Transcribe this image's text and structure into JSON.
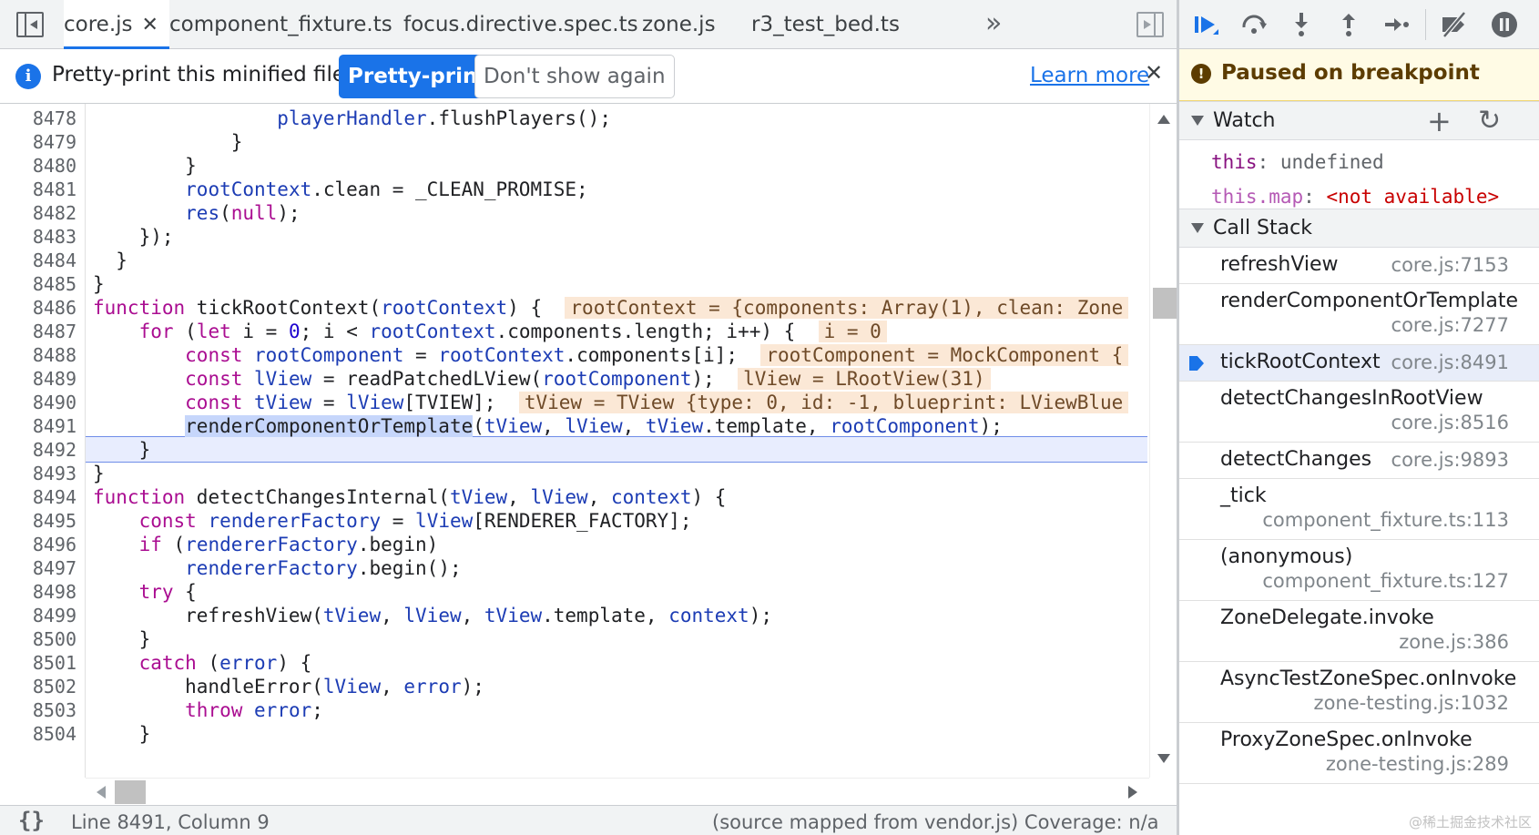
{
  "tabs": [
    {
      "label": "core.js",
      "active": true,
      "closable": true
    },
    {
      "label": "component_fixture.ts"
    },
    {
      "label": "focus.directive.spec.ts"
    },
    {
      "label": "zone.js"
    },
    {
      "label": "r3_test_bed.ts"
    }
  ],
  "icons": {
    "navigator": "sidebar-toggle-icon",
    "more_tabs": "double-chevron-right-icon",
    "debugger_toggle": "sidebar-toggle-icon",
    "info": "info-icon",
    "close": "close-icon",
    "resume": "resume-icon",
    "step_over": "step-over-icon",
    "step_into": "step-into-icon",
    "step_out": "step-out-icon",
    "step": "step-icon",
    "deactivate_breakpoints": "deactivate-breakpoints-icon",
    "pause_on_exceptions": "pause-icon",
    "add": "plus-icon",
    "refresh": "refresh-icon",
    "format": "curly-braces-icon"
  },
  "infobar": {
    "message": "Pretty-print this minified file?",
    "pretty_print": "Pretty-print",
    "dont_show": "Don't show again",
    "learn_more": "Learn more",
    "close": "✕"
  },
  "tab_close": "✕",
  "tabs_more": "»",
  "editor": {
    "lines": [
      {
        "no": "8478",
        "code": "                playerHandler.flushPlayers();"
      },
      {
        "no": "8479",
        "code": "            }"
      },
      {
        "no": "8480",
        "code": "        }"
      },
      {
        "no": "8481",
        "code": "        rootContext.clean = _CLEAN_PROMISE;"
      },
      {
        "no": "8482",
        "code": "        res(null);"
      },
      {
        "no": "8483",
        "code": "    });"
      },
      {
        "no": "8484",
        "code": "  }"
      },
      {
        "no": "8485",
        "code": "}"
      },
      {
        "no": "8486",
        "code": "function tickRootContext(rootContext) {",
        "inline": "rootContext = {components: Array(1), clean: Zone"
      },
      {
        "no": "8487",
        "code": "    for (let i = 0; i < rootContext.components.length; i++) {",
        "inline": "i = 0"
      },
      {
        "no": "8488",
        "code": "        const rootComponent = rootContext.components[i];",
        "inline": "rootComponent = MockComponent {"
      },
      {
        "no": "8489",
        "code": "        const lView = readPatchedLView(rootComponent);",
        "inline": "lView = LRootView(31)"
      },
      {
        "no": "8490",
        "code": "        const tView = lView[TVIEW];",
        "inline": "tView = TView {type: 0, id: -1, blueprint: LViewBlue"
      },
      {
        "no": "8491",
        "code": "        renderComponentOrTemplate(tView, lView, tView.template, rootComponent);",
        "current": true
      },
      {
        "no": "8492",
        "code": "    }"
      },
      {
        "no": "8493",
        "code": "}"
      },
      {
        "no": "8494",
        "code": "function detectChangesInternal(tView, lView, context) {"
      },
      {
        "no": "8495",
        "code": "    const rendererFactory = lView[RENDERER_FACTORY];"
      },
      {
        "no": "8496",
        "code": "    if (rendererFactory.begin)"
      },
      {
        "no": "8497",
        "code": "        rendererFactory.begin();"
      },
      {
        "no": "8498",
        "code": "    try {"
      },
      {
        "no": "8499",
        "code": "        refreshView(tView, lView, tView.template, context);"
      },
      {
        "no": "8500",
        "code": "    }"
      },
      {
        "no": "8501",
        "code": "    catch (error) {"
      },
      {
        "no": "8502",
        "code": "        handleError(lView, error);"
      },
      {
        "no": "8503",
        "code": "        throw error;"
      },
      {
        "no": "8504",
        "code": "    }"
      }
    ]
  },
  "statusbar": {
    "format": "{}",
    "cursor": "Line 8491, Column 9",
    "source": "(source mapped from vendor.js)  Coverage: n/a"
  },
  "debugger": {
    "paused_text": "Paused on breakpoint",
    "paused_icon": "!",
    "watch": {
      "title": "Watch",
      "add": "+",
      "refresh": "↻",
      "items": [
        {
          "key": "this",
          "sep": ": ",
          "value": "undefined"
        },
        {
          "key": "this.map",
          "sep": ": ",
          "value": "<not available>"
        }
      ]
    },
    "call_stack": {
      "title": "Call Stack",
      "frames": [
        {
          "name": "refreshView",
          "loc": "core.js:7153",
          "wrap": false
        },
        {
          "name": "renderComponentOrTemplate",
          "loc": "core.js:7277",
          "wrap": true
        },
        {
          "name": "tickRootContext",
          "loc": "core.js:8491",
          "wrap": false,
          "selected": true
        },
        {
          "name": "detectChangesInRootView",
          "loc": "core.js:8516",
          "wrap": true
        },
        {
          "name": "detectChanges",
          "loc": "core.js:9893",
          "wrap": false
        },
        {
          "name": "_tick",
          "loc": "component_fixture.ts:113",
          "wrap": true
        },
        {
          "name": "(anonymous)",
          "loc": "component_fixture.ts:127",
          "wrap": true
        },
        {
          "name": "ZoneDelegate.invoke",
          "loc": "zone.js:386",
          "wrap": true
        },
        {
          "name": "AsyncTestZoneSpec.onInvoke",
          "loc": "zone-testing.js:1032",
          "wrap": true
        },
        {
          "name": "ProxyZoneSpec.onInvoke",
          "loc": "zone-testing.js:289",
          "wrap": true
        }
      ]
    }
  },
  "watermark": "@稀土掘金技术社区"
}
